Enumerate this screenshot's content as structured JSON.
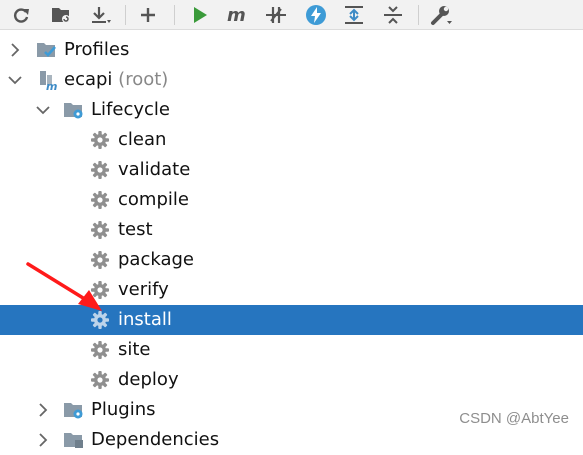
{
  "toolbar": {
    "buttons": [
      "refresh-icon",
      "maven-folder-icon",
      "download-icon",
      "add-icon",
      "run-icon",
      "maven-goal-icon",
      "toggle-offline-icon",
      "lightning-icon",
      "expand-all-icon",
      "collapse-all-icon",
      "wrench-icon"
    ]
  },
  "tree": {
    "profiles": {
      "label": "Profiles"
    },
    "project": {
      "label": "ecapi",
      "suffix": "(root)"
    },
    "lifecycle": {
      "label": "Lifecycle"
    },
    "phases": [
      {
        "label": "clean"
      },
      {
        "label": "validate"
      },
      {
        "label": "compile"
      },
      {
        "label": "test"
      },
      {
        "label": "package"
      },
      {
        "label": "verify"
      },
      {
        "label": "install"
      },
      {
        "label": "site"
      },
      {
        "label": "deploy"
      }
    ],
    "plugins": {
      "label": "Plugins"
    },
    "dependencies": {
      "label": "Dependencies"
    }
  },
  "selected": "install",
  "watermark": "CSDN @AbtYee",
  "colors": {
    "selection": "#2675bf",
    "annotation_arrow": "#ff1a1a",
    "run": "#3a9a3a",
    "folder": "#8a9aa8"
  }
}
